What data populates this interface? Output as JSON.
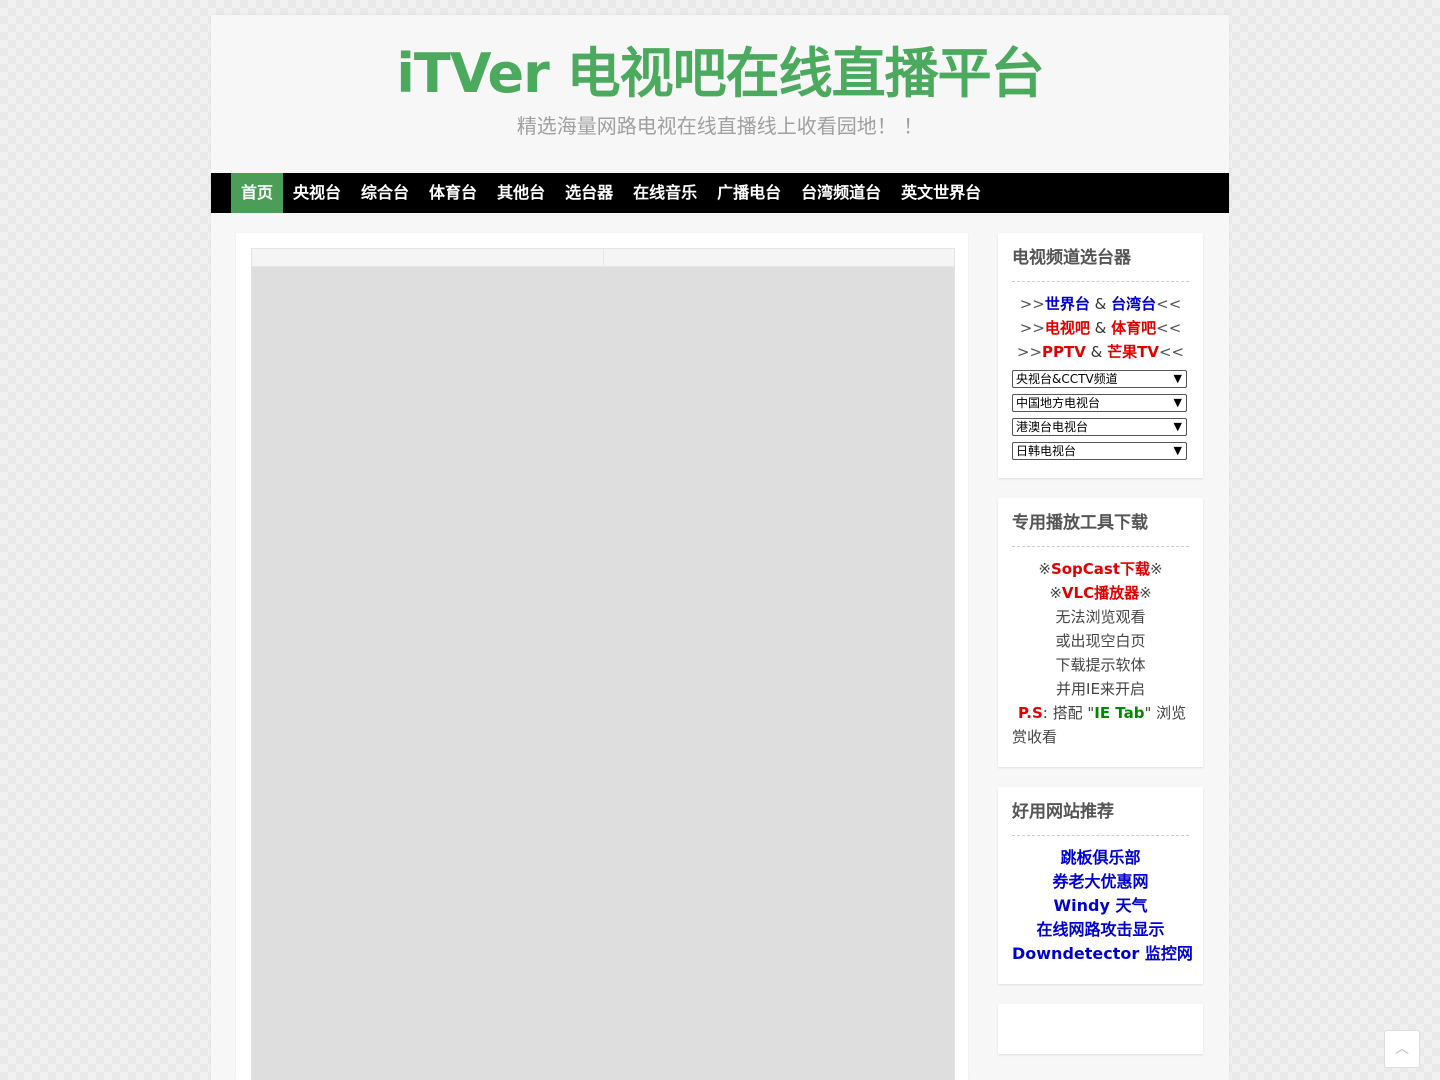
{
  "header": {
    "title": "iTVer 电视吧在线直播平台",
    "tagline": "精选海量网路电视在线直播线上收看园地！ ！"
  },
  "nav": {
    "items": [
      "首页",
      "央视台",
      "综合台",
      "体育台",
      "其他台",
      "选台器",
      "在线音乐",
      "广播电台",
      "台湾频道台",
      "英文世界台"
    ],
    "active": "首页"
  },
  "widgets": {
    "channel_selector": {
      "title": "电视频道选台器",
      "row1": {
        "pre": ">>",
        "a": "世界台",
        "amp": " & ",
        "b": "台湾台",
        "post": "<<"
      },
      "row2": {
        "pre": ">>",
        "a": "电视吧",
        "amp": " & ",
        "b": "体育吧",
        "post": "<<"
      },
      "row3": {
        "pre": ">>",
        "a": "PPTV",
        "amp": " & ",
        "b": "芒果TV",
        "post": "<<"
      },
      "selects": [
        "央视台&CCTV频道",
        "中国地方电视台",
        "港澳台电视台",
        "日韩电视台"
      ]
    },
    "tools": {
      "title": "专用播放工具下载",
      "sopcast": {
        "pre": "※",
        "label": "SopCast下载",
        "post": "※"
      },
      "vlc": {
        "pre": "※",
        "label": "VLC播放器",
        "post": "※"
      },
      "lines": [
        "无法浏览观看",
        "或出现空白页",
        "下载提示软体",
        "并用IE来开启"
      ],
      "ps": {
        "label": "P.S",
        "text1": ": 搭配 \"",
        "ietab": "IE Tab",
        "text2": "\" 浏览赏收看"
      }
    },
    "sites": {
      "title": "好用网站推荐",
      "links": [
        "跳板俱乐部",
        "券老大优惠网",
        "Windy 天气",
        "在线网路攻击显示",
        "Downdetector 监控网"
      ]
    }
  },
  "colors": {
    "brand_green": "#4caa5e",
    "nav_active": "#4b9d57",
    "link_blue": "#0000cc",
    "link_red": "#e00000"
  },
  "icons": {
    "back_to_top": "chevron-up-icon"
  }
}
